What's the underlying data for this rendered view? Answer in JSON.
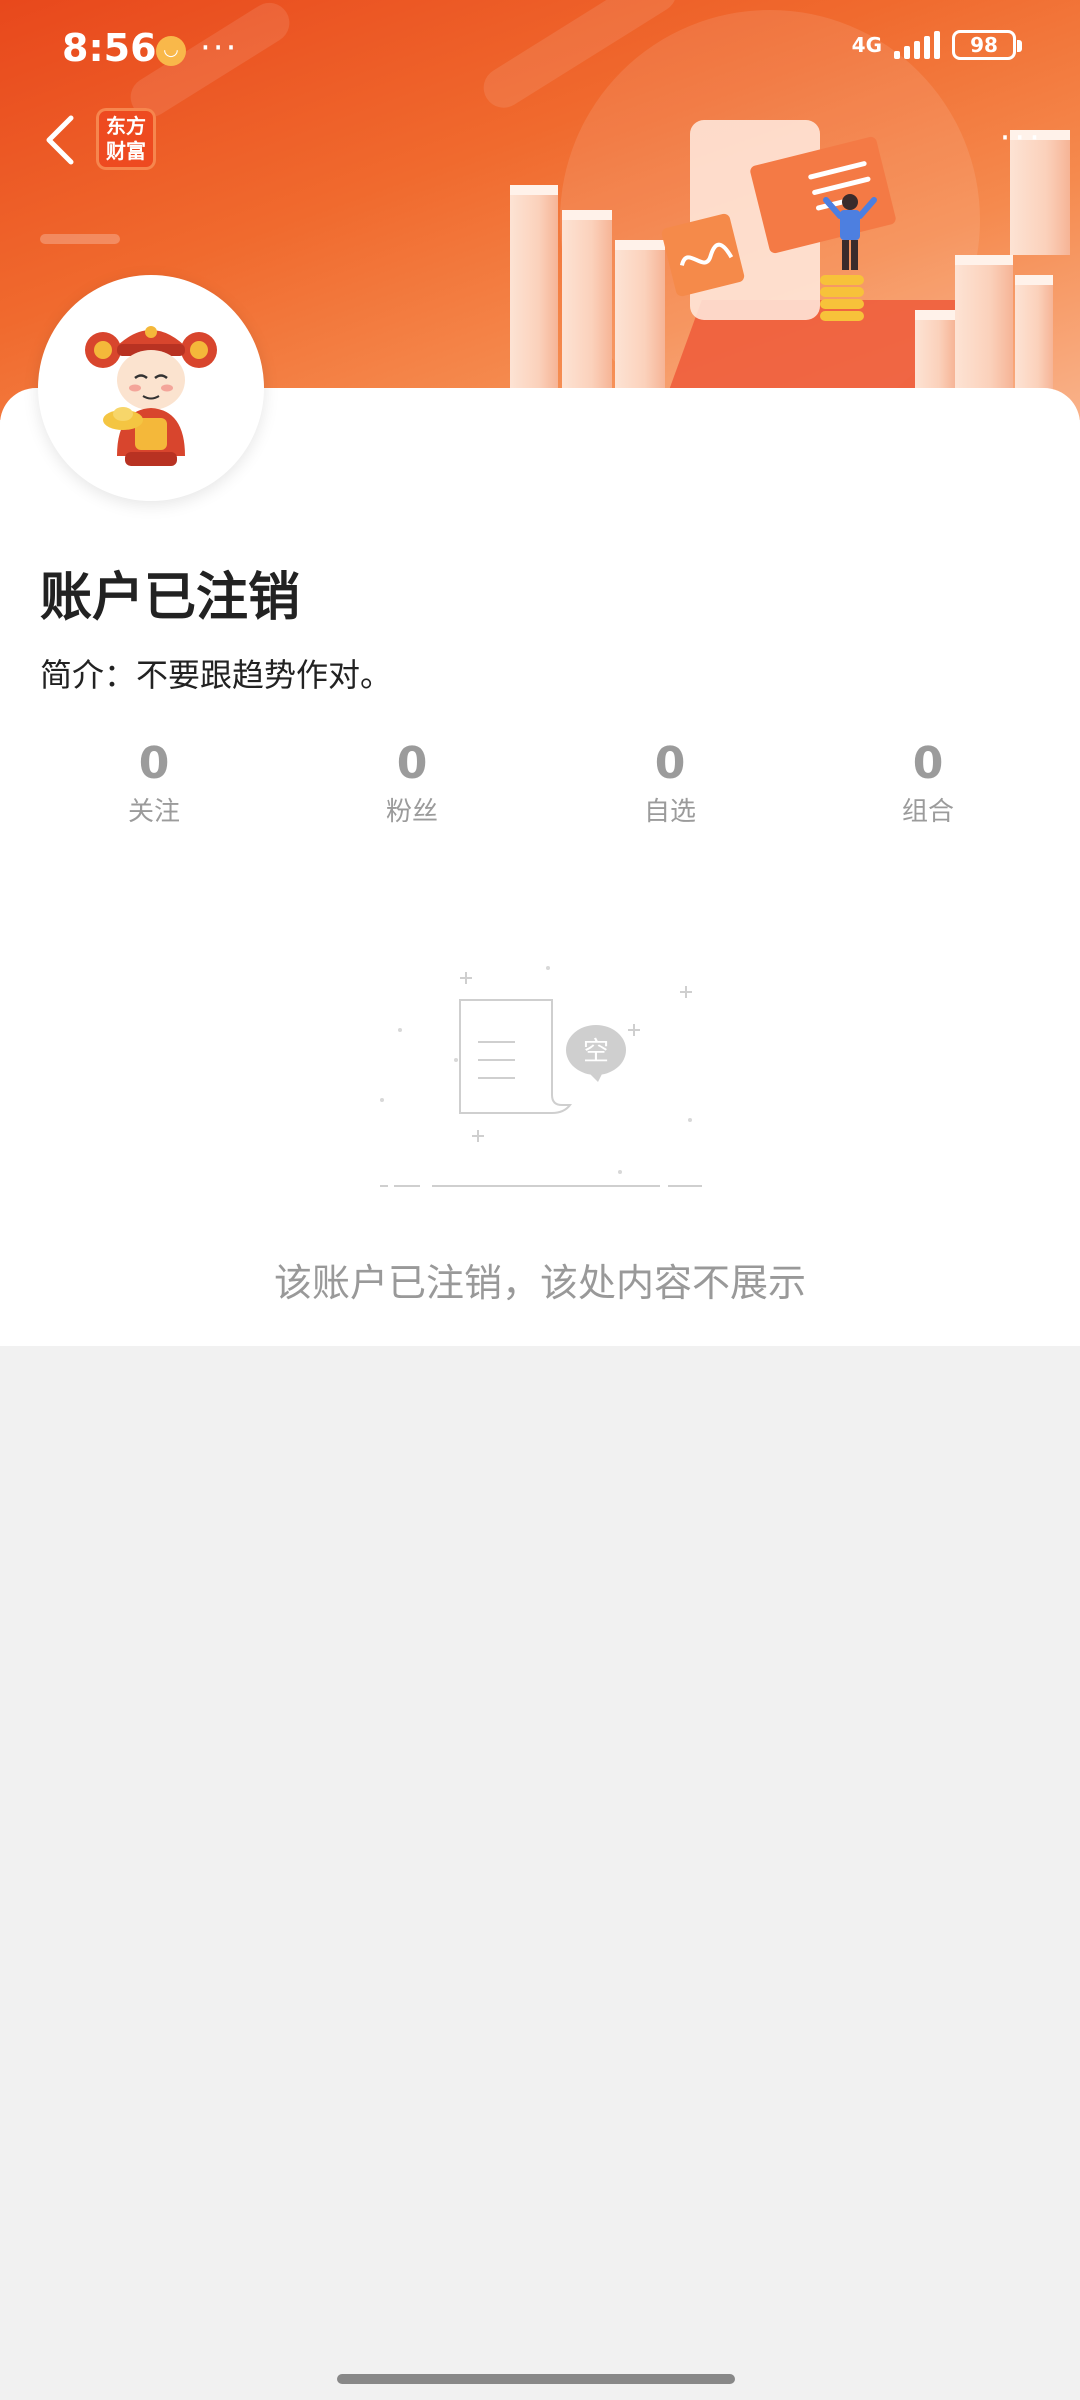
{
  "status_bar": {
    "time": "8:56",
    "more": "···",
    "network": "4G",
    "battery": "98"
  },
  "nav": {
    "back_icon": "chevron-left-icon",
    "logo_line1": "东方",
    "logo_line2": "财富",
    "more": "···"
  },
  "profile": {
    "name": "账户已注销",
    "bio": "简介：不要跟趋势作对。",
    "stats": [
      {
        "count": "0",
        "label": "关注"
      },
      {
        "count": "0",
        "label": "粉丝"
      },
      {
        "count": "0",
        "label": "自选"
      },
      {
        "count": "0",
        "label": "组合"
      }
    ]
  },
  "empty_state": {
    "badge": "空",
    "message": "该账户已注销，该处内容不展示"
  },
  "colors": {
    "accent": "#ee4a20",
    "muted_text": "#999999"
  }
}
